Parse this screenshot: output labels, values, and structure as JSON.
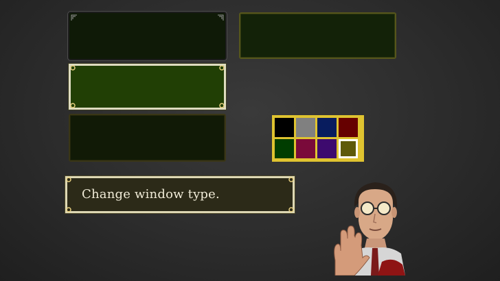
{
  "message": {
    "text": "Change window type."
  },
  "windows": [
    {
      "id": "window-type-1",
      "fill": "#0f1a07",
      "border": "#4d4d4d"
    },
    {
      "id": "window-type-2",
      "fill": "#132208",
      "border": "#56561b"
    },
    {
      "id": "window-type-3",
      "fill": "#213f05",
      "border": "#dedcc0",
      "selected": true
    },
    {
      "id": "window-type-4",
      "fill": "#111a06",
      "border": "#3a3616"
    }
  ],
  "color_palette": {
    "frame": "#dfc330",
    "swatches": [
      "#000000",
      "#808080",
      "#081c5e",
      "#660000",
      "#003d00",
      "#7a0a3a",
      "#3d0a6e",
      "#5e5a0a"
    ],
    "selected_index": 7
  },
  "portrait": {
    "icon": "scientist-portrait-icon"
  }
}
